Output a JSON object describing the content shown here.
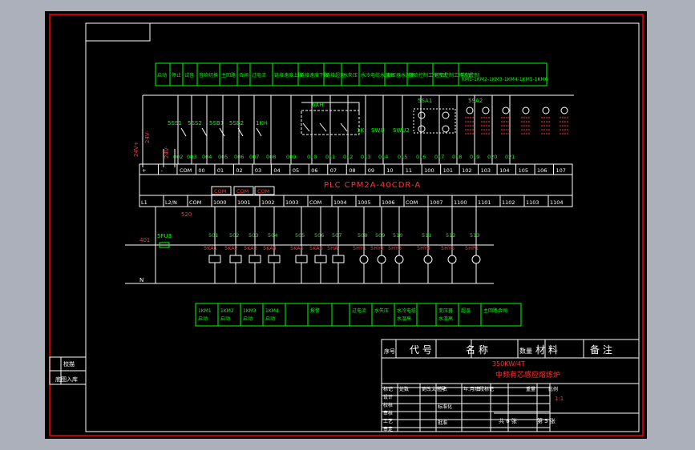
{
  "colors": {
    "background": "#abb0bb",
    "sheet": "#000000",
    "frame": "#ff0000",
    "line": "#ffffff",
    "green": "#00ff00",
    "cyan": "#00ffff",
    "red": "#ff3333",
    "magenta": "#ff00ff"
  },
  "top_table": [
    "启动",
    "停止",
    "试音",
    "音响切换",
    "主回路",
    "合闸",
    "过电流",
    "链接速度上限",
    "链接速度下限",
    "链接超速",
    "水失压",
    "水冷电缆水温高",
    "变压器水温高",
    "整流控制工作方式",
    "逆变控制工作方式",
    "手动控制"
  ],
  "top_table_kml": "KM1-1KM2-1KM3-1KM4-1KM5-1KM6",
  "switch_labels": [
    "5SS1",
    "5SS2",
    "5SB1",
    "5SB2",
    "1KH",
    "6XH",
    "5SA1",
    "5SA2",
    "SWU",
    "SWU2"
  ],
  "relay_labels": [
    "1K"
  ],
  "voltage_labels": [
    "24V+",
    "24V-",
    "24V-"
  ],
  "input_numbers": [
    "002",
    "003",
    "004",
    "005",
    "006",
    "007",
    "008",
    "009",
    "010",
    "011",
    "012",
    "013",
    "014",
    "015",
    "016",
    "017",
    "018",
    "019",
    "020",
    "021"
  ],
  "plc_top_terminals": [
    "+",
    "-",
    "COM",
    "00",
    "01",
    "02",
    "03",
    "04",
    "05",
    "06",
    "07",
    "08",
    "09",
    "10",
    "11",
    "100",
    "101",
    "102",
    "103",
    "104",
    "105",
    "106",
    "107"
  ],
  "plc_name": "PLC  CPM2A-40CDR-A",
  "plc_com": [
    "COM",
    "COM",
    "COM"
  ],
  "plc_bottom_terminals": [
    "L1",
    "L2/N",
    "COM",
    "1000",
    "1001",
    "1002",
    "1003",
    "COM",
    "1004",
    "1005",
    "1006",
    "COM",
    "1007",
    "1100",
    "1101",
    "1102",
    "1103",
    "1104"
  ],
  "wire_520": "520",
  "wire_401": "401",
  "fuse": "5FU3",
  "neutral": "N",
  "output_numbers": [
    "501",
    "502",
    "503",
    "504",
    "505",
    "506",
    "507",
    "508",
    "509",
    "510",
    "511",
    "512",
    "513"
  ],
  "output_devices": [
    "5KA1",
    "5KA2",
    "5KA3",
    "5KA4",
    "5KA5",
    "5KA6",
    "5HA",
    "5HY1",
    "5HY2",
    "5HY3",
    "5HY4",
    "5HY5",
    "5HP1"
  ],
  "bottom_table": [
    {
      "a": "1KM1",
      "b": "启动"
    },
    {
      "a": "1KM2",
      "b": "启动"
    },
    {
      "a": "1KM3",
      "b": "启动"
    },
    {
      "a": "1KM4",
      "b": "启动"
    },
    {
      "a": "",
      "b": ""
    },
    {
      "a": "报警",
      "b": ""
    },
    {
      "a": "",
      "b": ""
    },
    {
      "a": "过电流",
      "b": ""
    },
    {
      "a": "水失压",
      "b": ""
    },
    {
      "a": "水冷电缆",
      "b": "水温高"
    },
    {
      "a": "",
      "b": ""
    },
    {
      "a": "变压器",
      "b": "水温高"
    },
    {
      "a": "超温",
      "b": ""
    },
    {
      "a": "主回路合闸",
      "b": ""
    }
  ],
  "title_block": {
    "header": [
      "序号",
      "代  号",
      "名  称",
      "数量",
      "材  料",
      "备  注"
    ],
    "drawing_code": "350KW/4T",
    "drawing_name": "中频有芯感应熔炼炉",
    "row_labels_left": [
      "标记",
      "设计",
      "校核",
      "审核",
      "工艺",
      "审定"
    ],
    "row_labels_mid": [
      "处数",
      "更改文件号",
      "签名",
      "年.月.日",
      "阶段标记",
      "重量",
      "比例"
    ],
    "scale": "1:1",
    "sheet_total": "共 6 张",
    "sheet_num": "第 5 张",
    "std_label": "标准化",
    "approve_label": "批准"
  },
  "side_labels": [
    "校描",
    "底图入库"
  ]
}
